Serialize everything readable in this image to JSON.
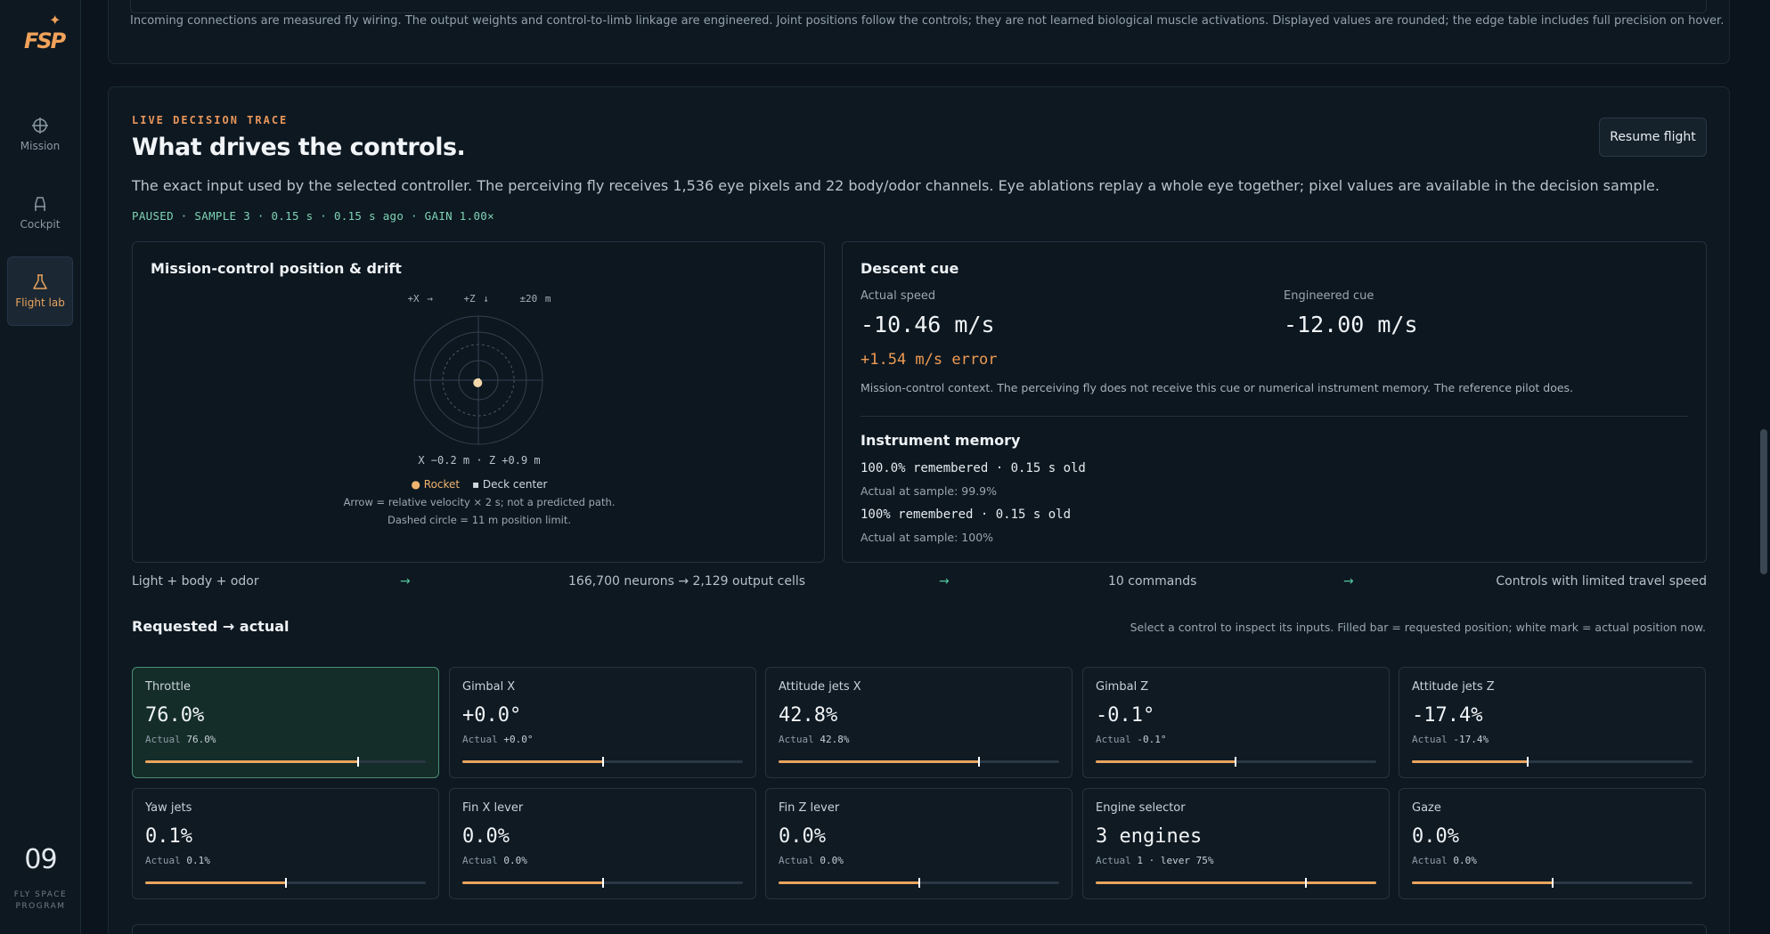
{
  "brand": {
    "logo_text": "FSP",
    "issue_number": "09",
    "issue_subtitle": "FLY SPACE PROGRAM"
  },
  "nav": [
    {
      "label": "Mission",
      "icon": "crosshair-icon",
      "active": false
    },
    {
      "label": "Cockpit",
      "icon": "seat-icon",
      "active": false
    },
    {
      "label": "Flight lab",
      "icon": "flask-icon",
      "active": true
    }
  ],
  "top_note": "Incoming connections are measured fly wiring. The output weights and control-to-limb linkage are engineered. Joint positions follow the controls; they are not learned biological muscle activations. Displayed values are rounded; the edge table includes full precision on hover.",
  "main": {
    "eyebrow": "LIVE DECISION TRACE",
    "title": "What drives the controls.",
    "description": "The exact input used by the selected controller. The perceiving fly receives 1,536 eye pixels and 22 body/odor channels. Eye ablations replay a whole eye together; pixel values are available in the decision sample.",
    "status": "PAUSED · SAMPLE 3 · 0.15 s · 0.15 s ago · GAIN 1.00×",
    "resume_label": "Resume flight"
  },
  "mission_control": {
    "title": "Mission-control position & drift",
    "axis_x": "+X →",
    "axis_z": "+Z ↓",
    "range": "±20 m",
    "readout": "X −0.2 m · Z +0.9 m",
    "legend_rocket": "● Rocket",
    "legend_deck": "▪ Deck center",
    "note_arrow": "Arrow = relative velocity × 2 s; not a predicted path.",
    "note_circle": "Dashed circle = 11 m position limit."
  },
  "descent": {
    "title": "Descent cue",
    "actual_label": "Actual speed",
    "actual_value": "-10.46 m/s",
    "cue_label": "Engineered cue",
    "cue_value": "-12.00 m/s",
    "error": "+1.54 m/s error",
    "context": "Mission-control context. The perceiving fly does not receive this cue or numerical instrument memory. The reference pilot does."
  },
  "memory": {
    "title": "Instrument memory",
    "line1": "100.0% remembered · 0.15 s old",
    "sub1": "Actual at sample: 99.9%",
    "line2": "100% remembered · 0.15 s old",
    "sub2": "Actual at sample: 100%"
  },
  "pipeline": {
    "step1": "Light + body + odor",
    "step2": "166,700 neurons → 2,129 output cells",
    "step3": "10 commands",
    "step4": "Controls with limited travel speed",
    "arrow": "→"
  },
  "requested": {
    "title": "Requested → actual",
    "hint": "Select a control to inspect its inputs. Filled bar = requested position; white mark = actual position now.",
    "actual_prefix": "Actual"
  },
  "controls": [
    {
      "name": "Throttle",
      "value": "76.0%",
      "actual": "76.0%",
      "requested_fraction": 0.76,
      "actual_fraction": 0.76,
      "selected": true
    },
    {
      "name": "Gimbal X",
      "value": "+0.0°",
      "actual": "+0.0°",
      "requested_fraction": 0.5,
      "actual_fraction": 0.5,
      "selected": false
    },
    {
      "name": "Attitude jets X",
      "value": "42.8%",
      "actual": "42.8%",
      "requested_fraction": 0.714,
      "actual_fraction": 0.714,
      "selected": false
    },
    {
      "name": "Gimbal Z",
      "value": "-0.1°",
      "actual": "-0.1°",
      "requested_fraction": 0.499,
      "actual_fraction": 0.499,
      "selected": false
    },
    {
      "name": "Attitude jets Z",
      "value": "-17.4%",
      "actual": "-17.4%",
      "requested_fraction": 0.413,
      "actual_fraction": 0.413,
      "selected": false
    },
    {
      "name": "Yaw jets",
      "value": "0.1%",
      "actual": "0.1%",
      "requested_fraction": 0.5005,
      "actual_fraction": 0.5005,
      "selected": false
    },
    {
      "name": "Fin X lever",
      "value": "0.0%",
      "actual": "0.0%",
      "requested_fraction": 0.5,
      "actual_fraction": 0.5,
      "selected": false
    },
    {
      "name": "Fin Z lever",
      "value": "0.0%",
      "actual": "0.0%",
      "requested_fraction": 0.5,
      "actual_fraction": 0.5,
      "selected": false
    },
    {
      "name": "Engine selector",
      "value": "3 engines",
      "actual": "1 · lever 75%",
      "requested_fraction": 1.0,
      "actual_fraction": 0.75,
      "selected": false
    },
    {
      "name": "Gaze",
      "value": "0.0%",
      "actual": "0.0%",
      "requested_fraction": 0.5,
      "actual_fraction": 0.5,
      "selected": false
    }
  ],
  "colors": {
    "accent": "#e9a45e",
    "status_green": "#7fd3b4",
    "selected_border": "#4c8f75",
    "background": "#0b141c"
  }
}
